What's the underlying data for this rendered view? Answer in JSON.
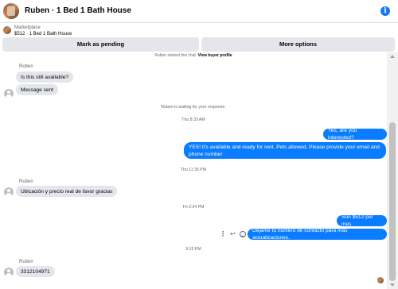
{
  "header": {
    "title": "Ruben · 1 Bed 1 Bath House",
    "info_icon": "info-icon"
  },
  "listing": {
    "label": "Marketplace",
    "subtitle": "$512 · 1 Bed 1 Bath House"
  },
  "actions": {
    "pending_label": "Mark as pending",
    "more_label": "More options"
  },
  "thread": {
    "started_prefix": "Ruben started this chat.",
    "started_link": "View buyer profile",
    "messages": [
      {
        "sender": "Ruben",
        "text": "Is this still available?"
      },
      {
        "text": "Message sent"
      },
      {
        "system": "Ruben is waiting for your response."
      },
      {
        "timestamp": "Thu 8:33 AM"
      },
      {
        "text": "Yes, are you interested?"
      },
      {
        "text": "YES! it's available and ready for rent. Pets allowed. Please provide your email and phone number"
      },
      {
        "timestamp": "Thu 11:36 PM"
      },
      {
        "sender": "Ruben",
        "text": "Ubicación  y precio  real de favor gracias"
      },
      {
        "timestamp": "Fri 2:34 PM"
      },
      {
        "text": "Son $512 por mes"
      },
      {
        "text": "Déjame tu número de contacto para más actualizaciones."
      },
      {
        "timestamp": "9:15 PM"
      },
      {
        "sender": "Ruben",
        "text": "3312104971"
      }
    ]
  },
  "colors": {
    "outgoing": "#0a7cff",
    "incoming": "#e4e6eb",
    "accent": "#1877f2"
  }
}
